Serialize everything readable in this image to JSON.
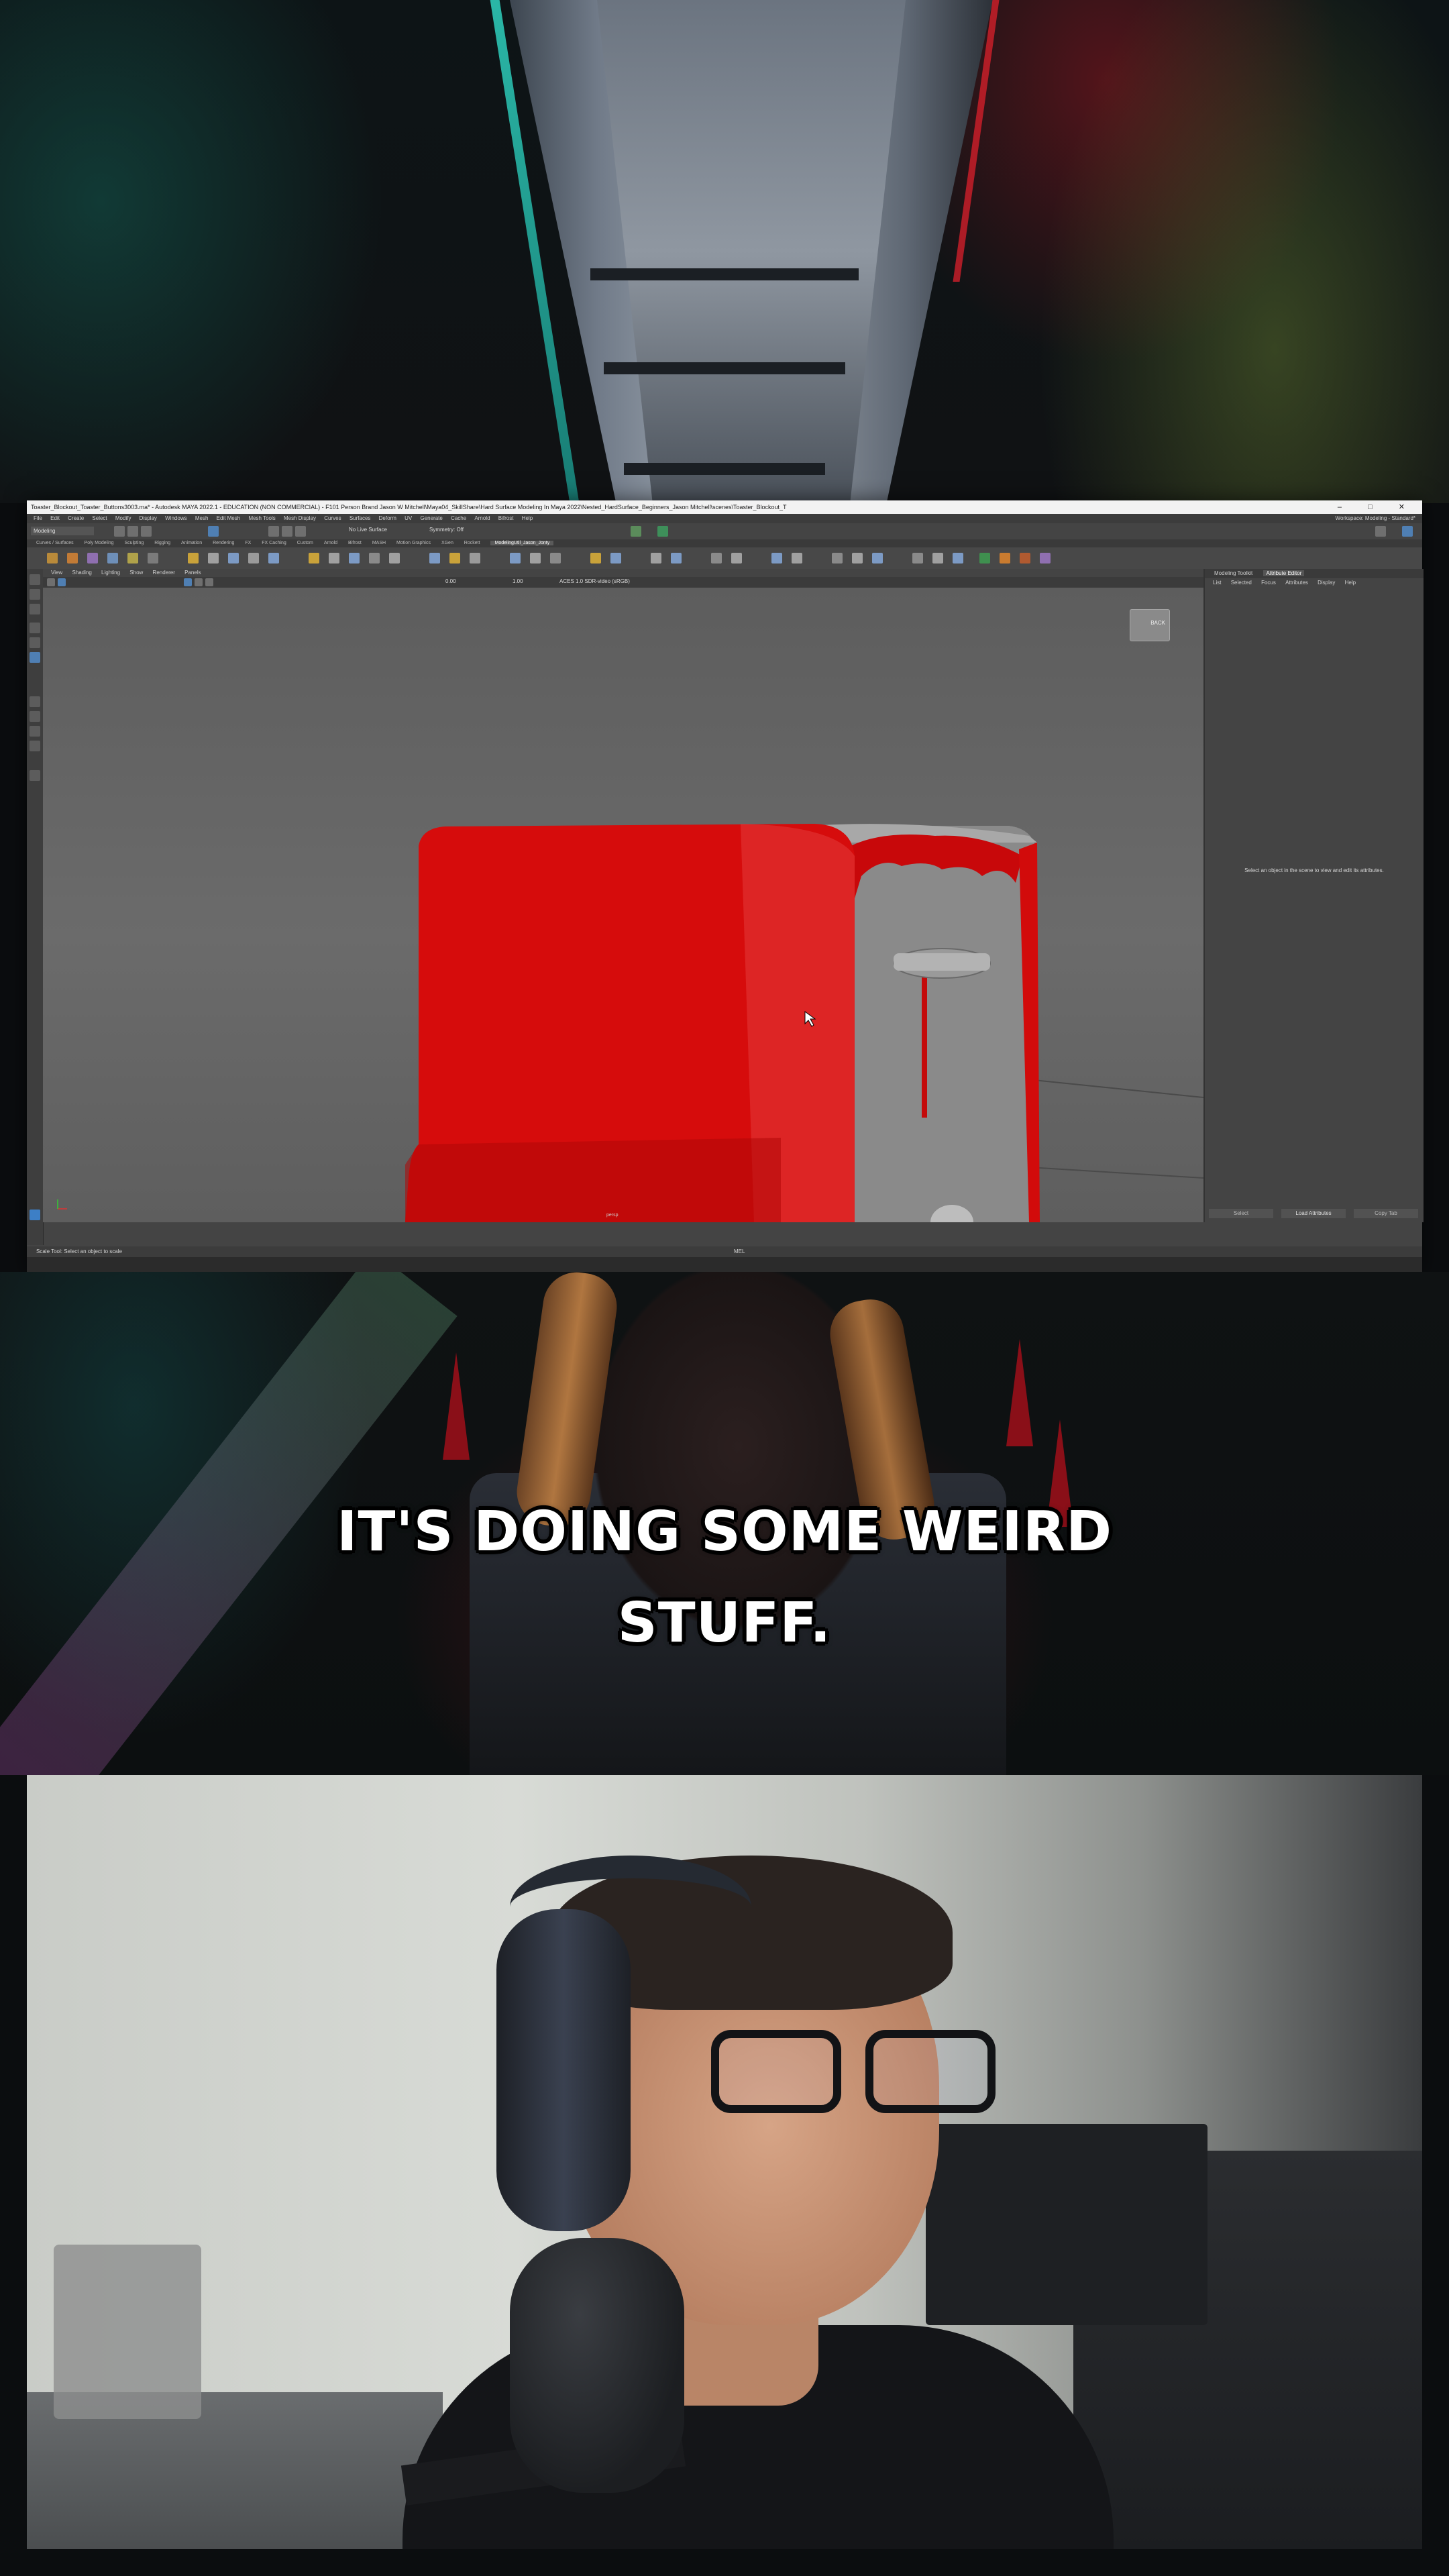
{
  "maya": {
    "title": "Toaster_Blockout_Toaster_Buttons3003.ma* - Autodesk MAYA 2022.1 - EDUCATION (NON COMMERCIAL) - F101 Person Brand Jason W Mitchell\\Maya04_SkillShare\\Hard Surface Modeling In Maya 2022\\Nested_HardSurface_Beginners_Jason Mitchell\\scenes\\Toaster_Blockout_T",
    "window_controls": [
      "–",
      "□",
      "✕"
    ],
    "menu": [
      "File",
      "Edit",
      "Create",
      "Select",
      "Modify",
      "Display",
      "Windows",
      "Mesh",
      "Edit Mesh",
      "Mesh Tools",
      "Mesh Display",
      "Curves",
      "Surfaces",
      "Deform",
      "UV",
      "Generate",
      "Cache",
      "Arnold",
      "Bifrost",
      "Help"
    ],
    "workspace": "Workspace: Modeling - Standard*",
    "mode_dropdown": "Modeling",
    "live_surface": "No Live Surface",
    "symmetry": "Symmetry: Off",
    "shelf_tabs": [
      "Curves / Surfaces",
      "Poly Modeling",
      "Sculpting",
      "Rigging",
      "Animation",
      "Rendering",
      "FX",
      "FX Caching",
      "Custom",
      "Arnold",
      "Bifrost",
      "MASH",
      "Motion Graphics",
      "XGen",
      "Rockett",
      "ModelingUtil_Jason_Jonty"
    ],
    "active_shelf_tab": "ModelingUtil_Jason_Jonty",
    "panel_menu": [
      "View",
      "Shading",
      "Lighting",
      "Show",
      "Renderer",
      "Panels"
    ],
    "panel_toolbar_values": [
      "0.00",
      "1.00",
      "ACES 1.0 SDR-video (sRGB)"
    ],
    "viewcube_label": "BACK",
    "camera_label": "persp",
    "attr_tabs": [
      "Modeling Toolkit",
      "Attribute Editor"
    ],
    "attr_active_tab": "Attribute Editor",
    "attr_menu": [
      "List",
      "Selected",
      "Focus",
      "Attributes",
      "Display",
      "Help"
    ],
    "attr_message": "Select an object in the scene to view and edit its attributes.",
    "attr_buttons": [
      "Select",
      "Load Attributes",
      "Copy Tab"
    ],
    "help_line": "Scale Tool: Select an object to scale",
    "mel_label": "MEL"
  },
  "caption": {
    "line1": "IT'S DOING SOME WEIRD",
    "line2": "STUFF."
  },
  "colors": {
    "toaster_red": "#d60c0c",
    "toaster_grey": "#8c8c8c",
    "maya_bg": "#444444",
    "caption_text": "#ffffff"
  }
}
